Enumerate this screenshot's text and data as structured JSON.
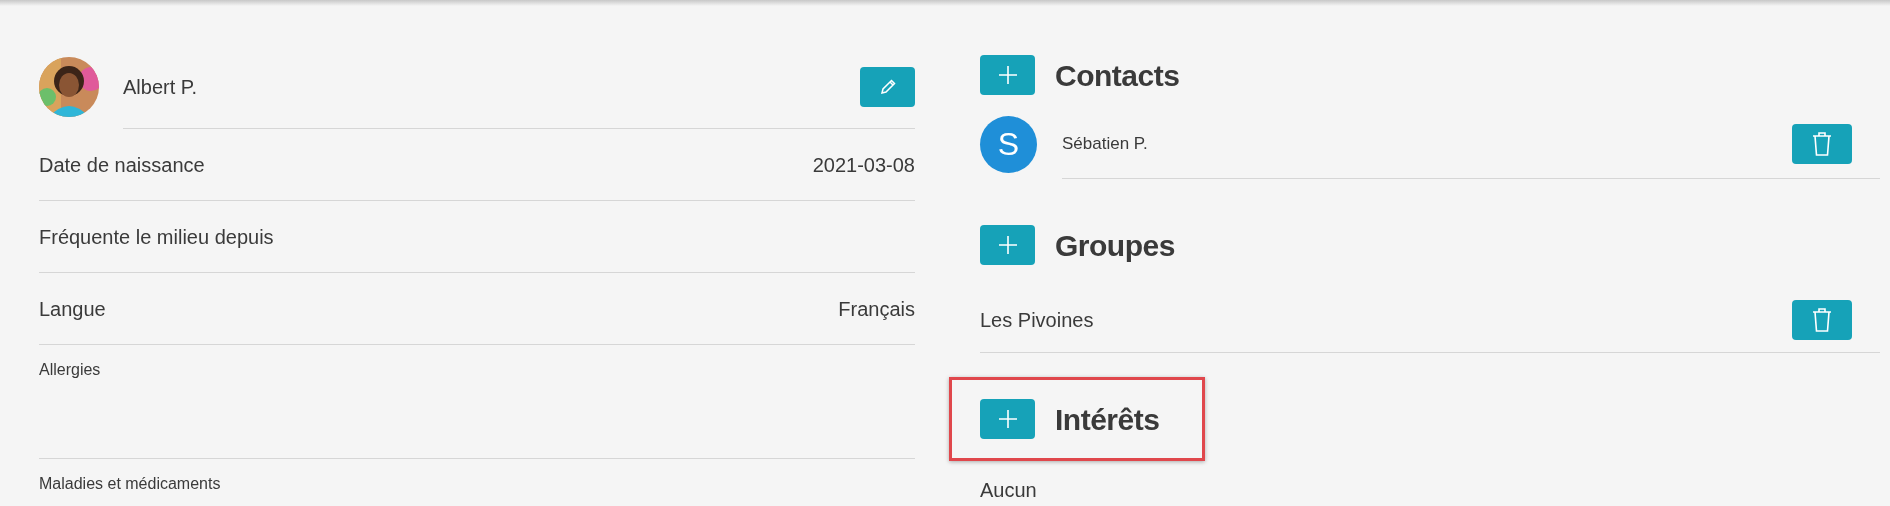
{
  "profile": {
    "name": "Albert P."
  },
  "fields": [
    {
      "kind": "row",
      "label": "Date de naissance",
      "value": "2021-03-08"
    },
    {
      "kind": "row",
      "label": "Fréquente le milieu depuis"
    },
    {
      "kind": "row",
      "label": "Langue",
      "value": "Français"
    },
    {
      "kind": "note",
      "label": "Allergies"
    },
    {
      "kind": "note",
      "label": "Maladies et médicaments"
    }
  ],
  "sections": [
    {
      "title": "Contacts",
      "highlighted": false,
      "items": [
        {
          "kind": "contact",
          "initial": "S",
          "name": "Sébatien P."
        }
      ]
    },
    {
      "title": "Groupes",
      "highlighted": false,
      "items": [
        {
          "kind": "group",
          "name": "Les Pivoines"
        }
      ]
    },
    {
      "title": "Intérêts",
      "highlighted": true,
      "empty_text": "Aucun"
    }
  ]
}
